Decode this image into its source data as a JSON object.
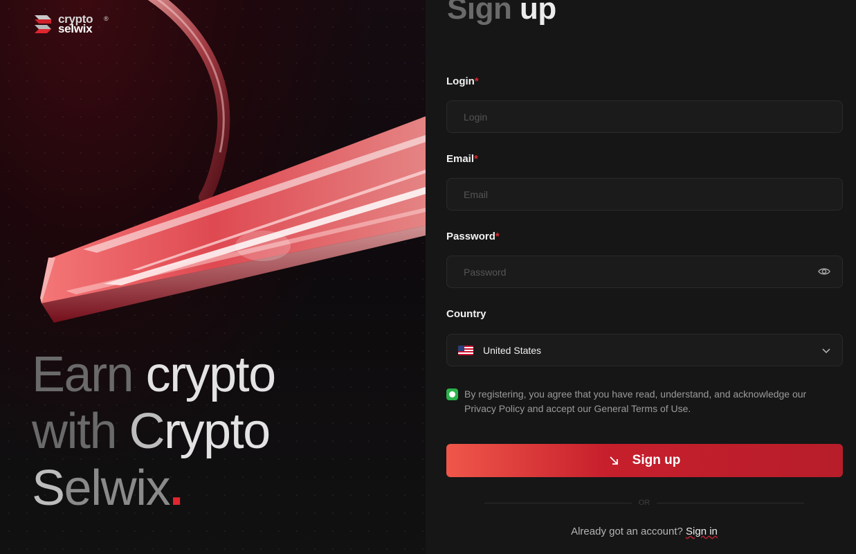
{
  "brand": {
    "line1": "crypto",
    "line2": "selwix",
    "reg": "®"
  },
  "hero": {
    "line1_dim": "Earn ",
    "line1_strong": "crypto",
    "line2_dim": "with ",
    "line2_strong_c": "C",
    "line2_strong": "rypto",
    "line3_s": "S",
    "line3_rest": "elwix",
    "dot": "."
  },
  "form": {
    "title_dim": "Sign",
    "title_strong": " up",
    "login": {
      "label": "Login",
      "required": "*",
      "placeholder": "Login"
    },
    "email": {
      "label": "Email",
      "required": "*",
      "placeholder": "Email"
    },
    "password": {
      "label": "Password",
      "required": "*",
      "placeholder": "Password"
    },
    "country": {
      "label": "Country",
      "value": "United States",
      "flag_icon": "us-flag-icon"
    },
    "consent": "By registering, you agree that you have read, understand, and acknowledge our Privacy Policy and accept our General Terms of Use.",
    "consent_checked": true,
    "submit_label": "Sign up",
    "divider": "OR",
    "already_text": "Already got an account? ",
    "signin_link": "Sign in"
  },
  "colors": {
    "accent": "#e0262f",
    "button_from": "#f0574a",
    "button_to": "#b71e2a",
    "check": "#2bb24c"
  }
}
